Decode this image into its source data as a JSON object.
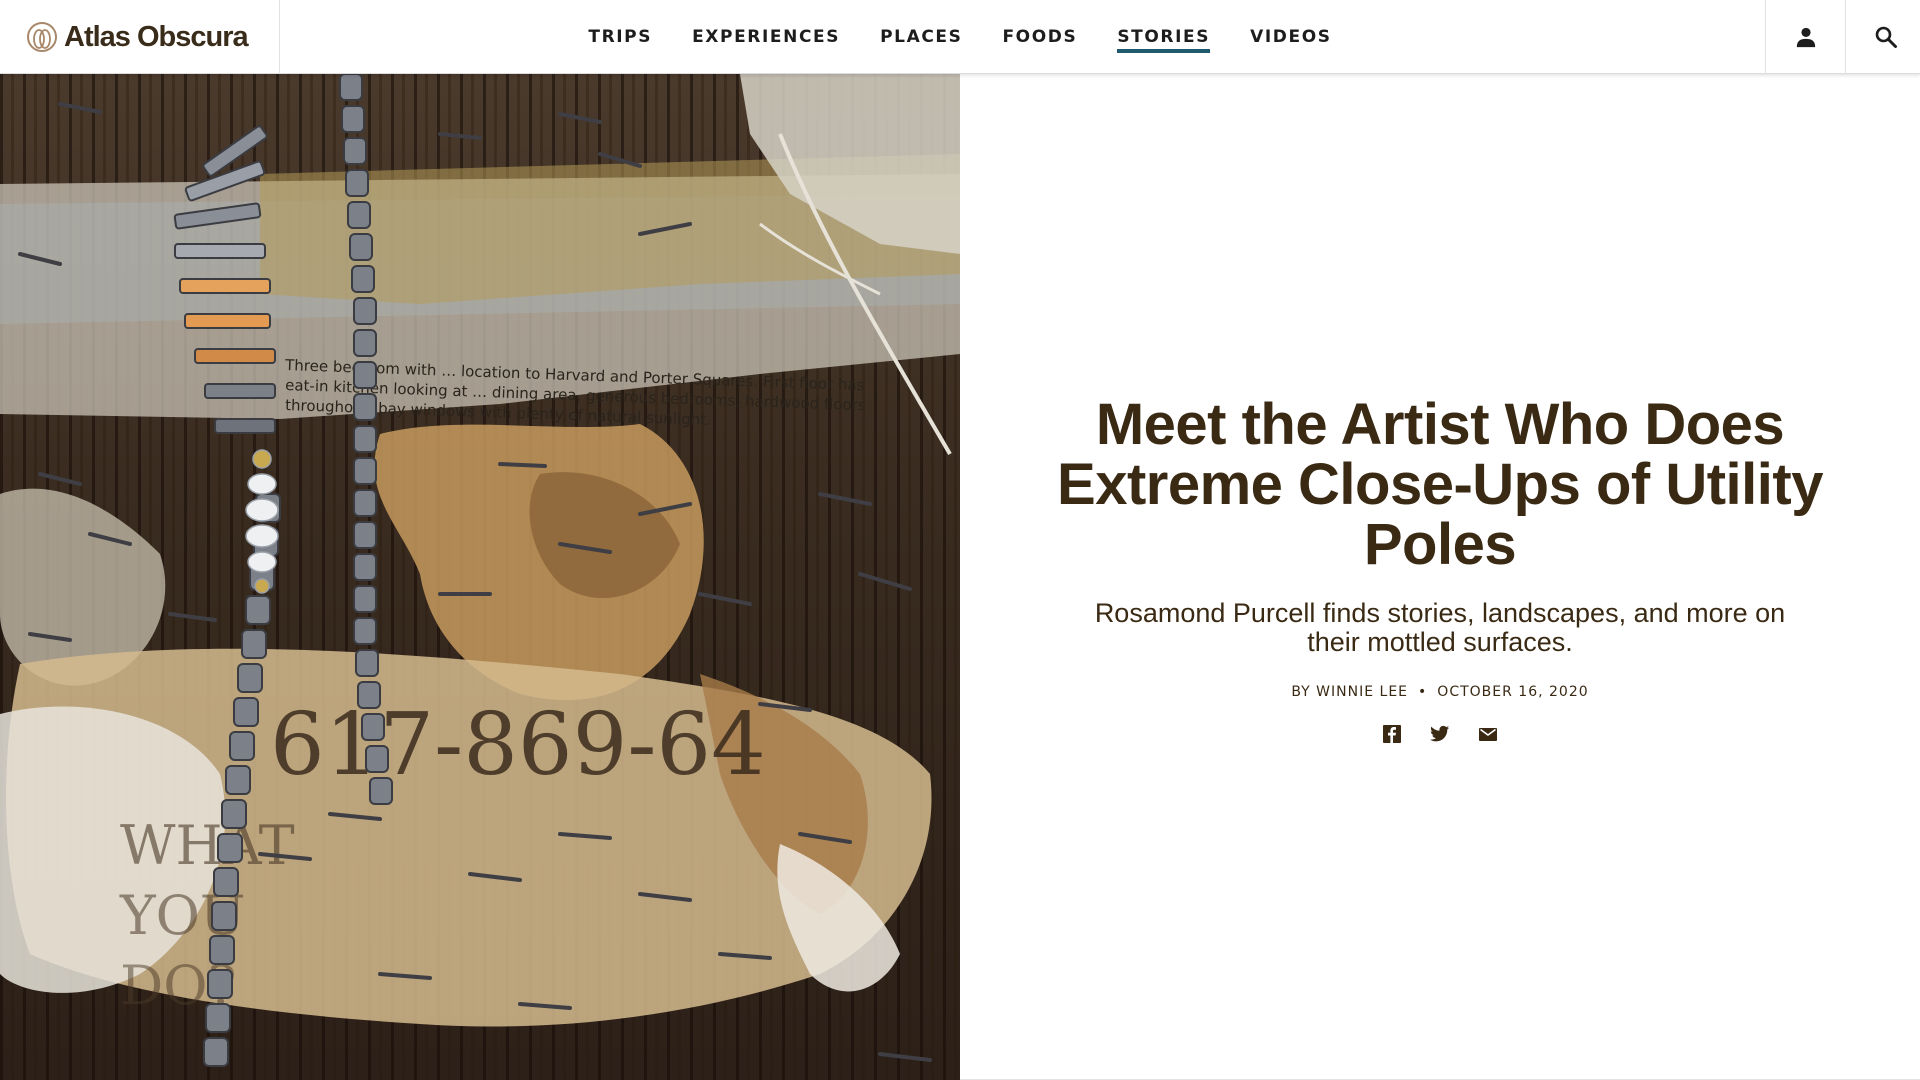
{
  "brand": {
    "name": "Atlas Obscura",
    "color": "#3a2c1a",
    "logo_icon": "atlas-obscura-logo-icon"
  },
  "nav": {
    "items": [
      {
        "label": "TRIPS",
        "active": false
      },
      {
        "label": "EXPERIENCES",
        "active": false
      },
      {
        "label": "PLACES",
        "active": false
      },
      {
        "label": "FOODS",
        "active": false
      },
      {
        "label": "STORIES",
        "active": true
      },
      {
        "label": "VIDEOS",
        "active": false
      }
    ],
    "active_underline_color": "#1f5a6e"
  },
  "header_buttons": {
    "account_icon": "person-icon",
    "search_icon": "search-icon"
  },
  "article": {
    "title": "Meet the Artist Who Does Extreme Close-Ups of Utility Poles",
    "subtitle": "Rosamond Purcell finds stories, landscapes, and more on their mottled surfaces.",
    "byline": "BY WINNIE LEE",
    "separator": "•",
    "date": "OCTOBER 16, 2020",
    "text_color": "#3a2a14",
    "share_icons": [
      "facebook-icon",
      "twitter-icon",
      "email-icon"
    ]
  },
  "hero_image": {
    "text_fragments": {
      "tape_line_1": "Three bedroom with … location to Harvard and Porter Squares. First floor has",
      "tape_line_2": "eat-in kitchen looking at … dining area, generous bedrooms, hardwood floors",
      "tape_line_3": "throughout, bay windows with plenty of natural sunlight.",
      "phone_number": "617-869-64",
      "sign_line_1": "WHAT",
      "sign_line_2": "YOU",
      "sign_line_3": "DO?"
    }
  }
}
